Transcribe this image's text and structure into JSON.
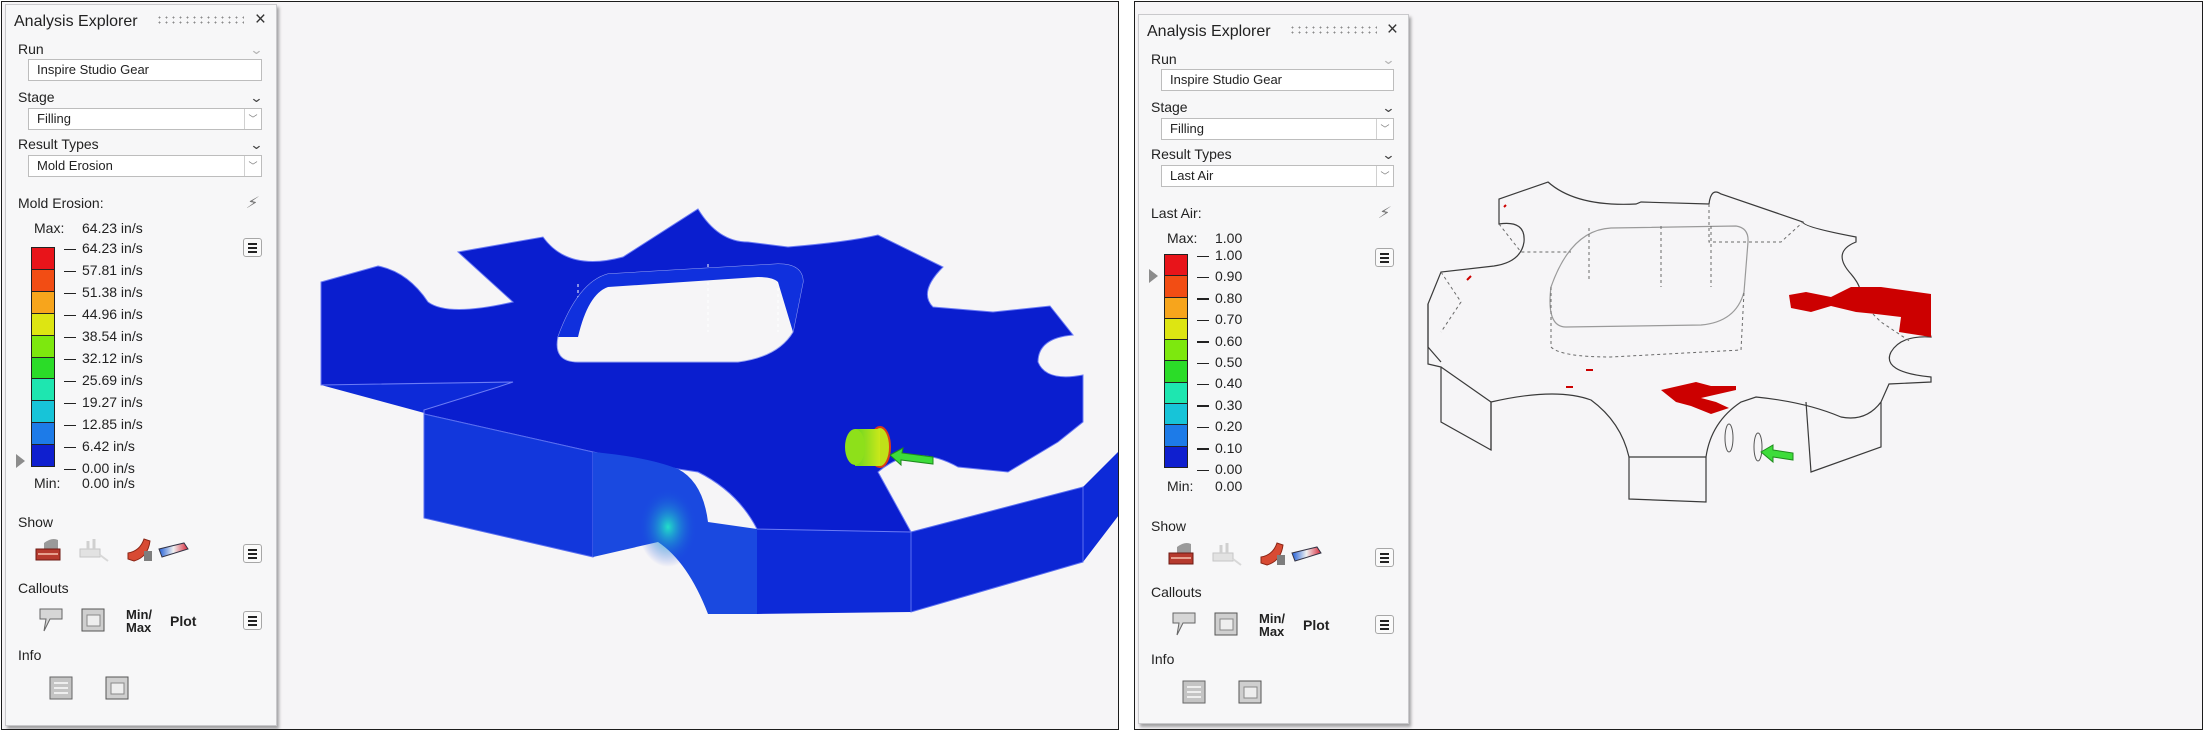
{
  "panels": [
    {
      "title": "Analysis Explorer",
      "run_label": "Run",
      "run_value": "Inspire Studio Gear",
      "stage_label": "Stage",
      "stage_value": "Filling",
      "result_types_label": "Result Types",
      "result_type_value": "Mold Erosion",
      "result_label": "Mold Erosion:",
      "legend": {
        "max_label": "Max:",
        "max_value": "64.23 in/s",
        "min_label": "Min:",
        "min_value": "0.00 in/s",
        "ticks": [
          "64.23 in/s",
          "57.81 in/s",
          "51.38 in/s",
          "44.96 in/s",
          "38.54 in/s",
          "32.12 in/s",
          "25.69 in/s",
          "19.27 in/s",
          "12.85 in/s",
          "6.42 in/s",
          "0.00 in/s"
        ],
        "marker_value": "0.00 in/s"
      },
      "show_label": "Show",
      "callouts_label": "Callouts",
      "minmax_label_1": "Min/",
      "minmax_label_2": "Max",
      "plot_label": "Plot",
      "info_label": "Info"
    },
    {
      "title": "Analysis Explorer",
      "run_label": "Run",
      "run_value": "Inspire Studio Gear",
      "stage_label": "Stage",
      "stage_value": "Filling",
      "result_types_label": "Result Types",
      "result_type_value": "Last Air",
      "result_label": "Last Air:",
      "legend": {
        "max_label": "Max:",
        "max_value": "1.00",
        "min_label": "Min:",
        "min_value": "0.00",
        "ticks": [
          "1.00",
          "0.90",
          "0.80",
          "0.70",
          "0.60",
          "0.50",
          "0.40",
          "0.30",
          "0.20",
          "0.10",
          "0.00"
        ],
        "marker_value": "0.90"
      },
      "show_label": "Show",
      "callouts_label": "Callouts",
      "minmax_label_1": "Min/",
      "minmax_label_2": "Max",
      "plot_label": "Plot",
      "info_label": "Info"
    }
  ],
  "colorbar_colors": [
    "#e8141a",
    "#f24d14",
    "#f7a51c",
    "#dde512",
    "#7de80e",
    "#2bdc28",
    "#1ee6b0",
    "#17c4d8",
    "#1d7be8",
    "#0f1fcf"
  ],
  "icons": {
    "close": "×",
    "double_chevron": "»",
    "dropdown_arrow": "▼",
    "bolt": "⚡"
  },
  "viewports": [
    {
      "name": "mold-erosion-view",
      "gear_color": "#0a1ecf",
      "hotspot_color": "#19d6c8",
      "gate_color": "#8ee01a",
      "inlet_arrow_color": "#3ddc3a"
    },
    {
      "name": "last-air-view",
      "gear_color": "#ffffff",
      "last_air_color": "#cc0000",
      "inlet_arrow_color": "#3ddc3a"
    }
  ]
}
